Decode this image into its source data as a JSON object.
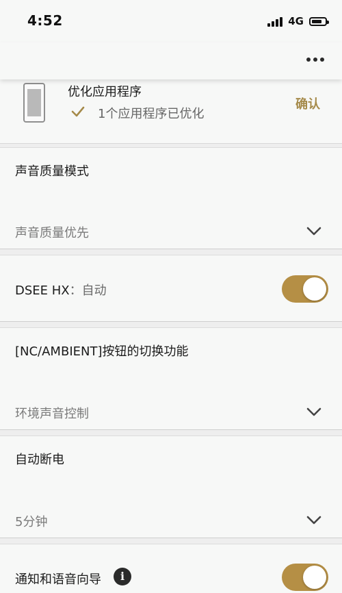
{
  "status_bar": {
    "time": "4:52",
    "network": "4G",
    "battery_level": 0.75
  },
  "optimize": {
    "title": "优化应用程序",
    "status": "1个应用程序已优化",
    "confirm_label": "确认"
  },
  "sound_quality": {
    "title": "声音质量模式",
    "value": "声音质量优先"
  },
  "dsee": {
    "title": "DSEE HX",
    "separator": "：",
    "value": "自动",
    "enabled": true
  },
  "nc_button": {
    "title": "[NC/AMBIENT]按钮的切换功能",
    "value": "环境声音控制"
  },
  "auto_power_off": {
    "title": "自动断电",
    "value": "5分钟"
  },
  "notification": {
    "title": "通知和语音向导",
    "enabled": true
  },
  "colors": {
    "accent": "#b58f45",
    "confirm": "#a58a4a"
  },
  "icons": [
    "signal-icon",
    "battery-icon",
    "more-icon",
    "phone-icon",
    "check-icon",
    "chevron-down-icon",
    "info-icon"
  ]
}
